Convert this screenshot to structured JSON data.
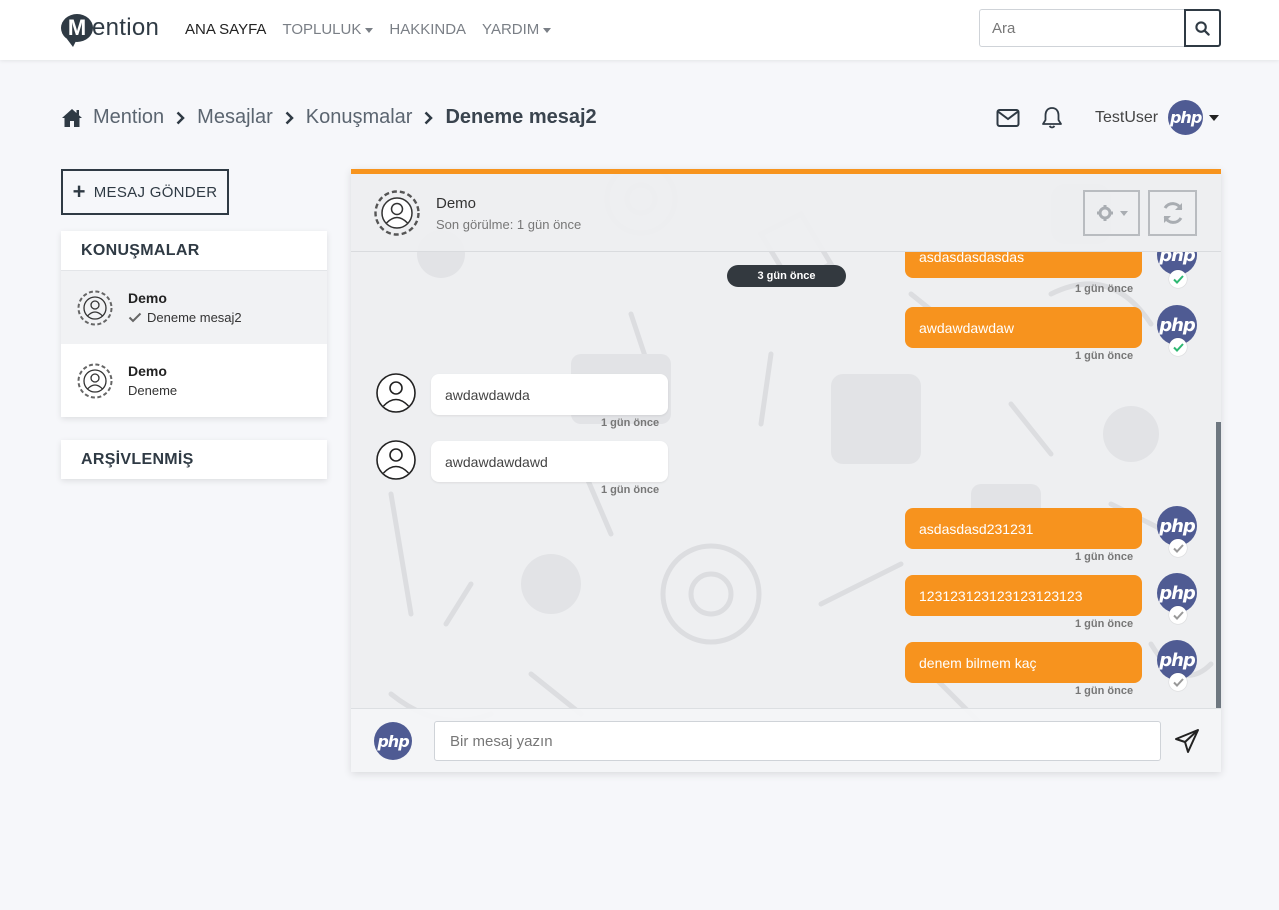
{
  "brand": {
    "first_letter": "M",
    "rest": "ention"
  },
  "nav": {
    "items": [
      {
        "label": "ANA SAYFA",
        "dropdown": false
      },
      {
        "label": "TOPLULUK",
        "dropdown": true
      },
      {
        "label": "HAKKINDA",
        "dropdown": false
      },
      {
        "label": "YARDIM",
        "dropdown": true
      }
    ]
  },
  "search": {
    "placeholder": "Ara"
  },
  "breadcrumb": {
    "items": [
      "Mention",
      "Mesajlar",
      "Konuşmalar"
    ],
    "current": "Deneme mesaj2"
  },
  "user": {
    "name": "TestUser",
    "avatar_text": "php"
  },
  "sidebar": {
    "send_button": "MESAJ GÖNDER",
    "conversations_title": "KONUŞMALAR",
    "conversations": [
      {
        "name": "Demo",
        "last_message": "Deneme mesaj2",
        "seen": true
      },
      {
        "name": "Demo",
        "last_message": "Deneme",
        "seen": false
      }
    ],
    "archived_title": "ARŞİVLENMİŞ"
  },
  "chat": {
    "contact_name": "Demo",
    "contact_status": "Son görülme: 1 gün önce",
    "date_divider": "3 gün önce",
    "messages": [
      {
        "direction": "out",
        "text": "asdasdasdasdas",
        "time": "1 gün önce",
        "seen": true
      },
      {
        "direction": "out",
        "text": "awdawdawdaw",
        "time": "1 gün önce",
        "seen": true
      },
      {
        "direction": "in",
        "text": "awdawdawda",
        "time": "1 gün önce"
      },
      {
        "direction": "in",
        "text": "awdawdawdawd",
        "time": "1 gün önce"
      },
      {
        "direction": "out",
        "text": "asdasdasd231231",
        "time": "1 gün önce",
        "seen": false
      },
      {
        "direction": "out",
        "text": "123123123123123123123",
        "time": "1 gün önce",
        "seen": false
      },
      {
        "direction": "out",
        "text": "denem bilmem kaç",
        "time": "1 gün önce",
        "seen": false
      }
    ],
    "composer_placeholder": "Bir mesaj yazın"
  },
  "colors": {
    "accent": "#f7941d",
    "dark": "#2f3a44",
    "php": "#4f5b93",
    "seen_check": "#2eb872"
  },
  "icons": [
    "search-icon",
    "home-icon",
    "chevron-right-icon",
    "mail-icon",
    "bell-icon",
    "plus-icon",
    "check-icon",
    "user-circle-icon",
    "gear-icon",
    "refresh-icon",
    "send-icon"
  ]
}
